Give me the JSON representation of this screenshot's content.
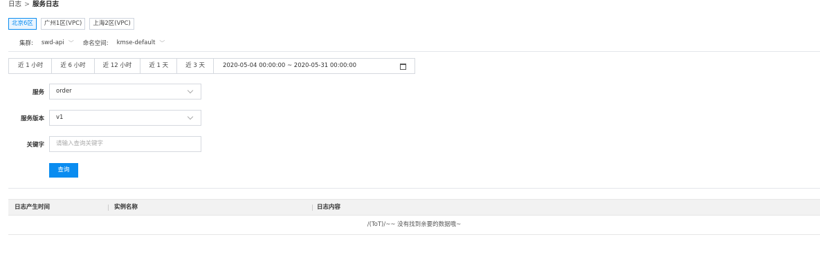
{
  "breadcrumb": {
    "parent": "日志",
    "separator": ">",
    "current": "服务日志"
  },
  "regions": [
    "北京6区",
    "广州1区(VPC)",
    "上海2区(VPC)"
  ],
  "active_region_index": 0,
  "selectors": {
    "cluster_label": "集群:",
    "cluster_value": "swd-api",
    "namespace_label": "命名空间:",
    "namespace_value": "kmse-default"
  },
  "time": {
    "presets": [
      "近 1 小时",
      "近 6 小时",
      "近 12 小时",
      "近 1 天",
      "近 3 天"
    ],
    "range": "2020-05-04 00:00:00 ~ 2020-05-31 00:00:00",
    "calendar_icon": "calendar-icon"
  },
  "form": {
    "service_label": "服务",
    "service_value": "order",
    "version_label": "服务版本",
    "version_value": "v1",
    "keyword_label": "关键字",
    "keyword_placeholder": "请输入查询关键字",
    "query_button": "查询"
  },
  "table": {
    "columns": [
      "日志产生时间",
      "实例名称",
      "日志内容"
    ],
    "empty_text": "/(ToT)/~~ 没有找到亲要的数据哦~"
  },
  "colors": {
    "accent": "#0a8cf0",
    "header_bg": "#f2f2f2",
    "border": "#d5d9df"
  }
}
